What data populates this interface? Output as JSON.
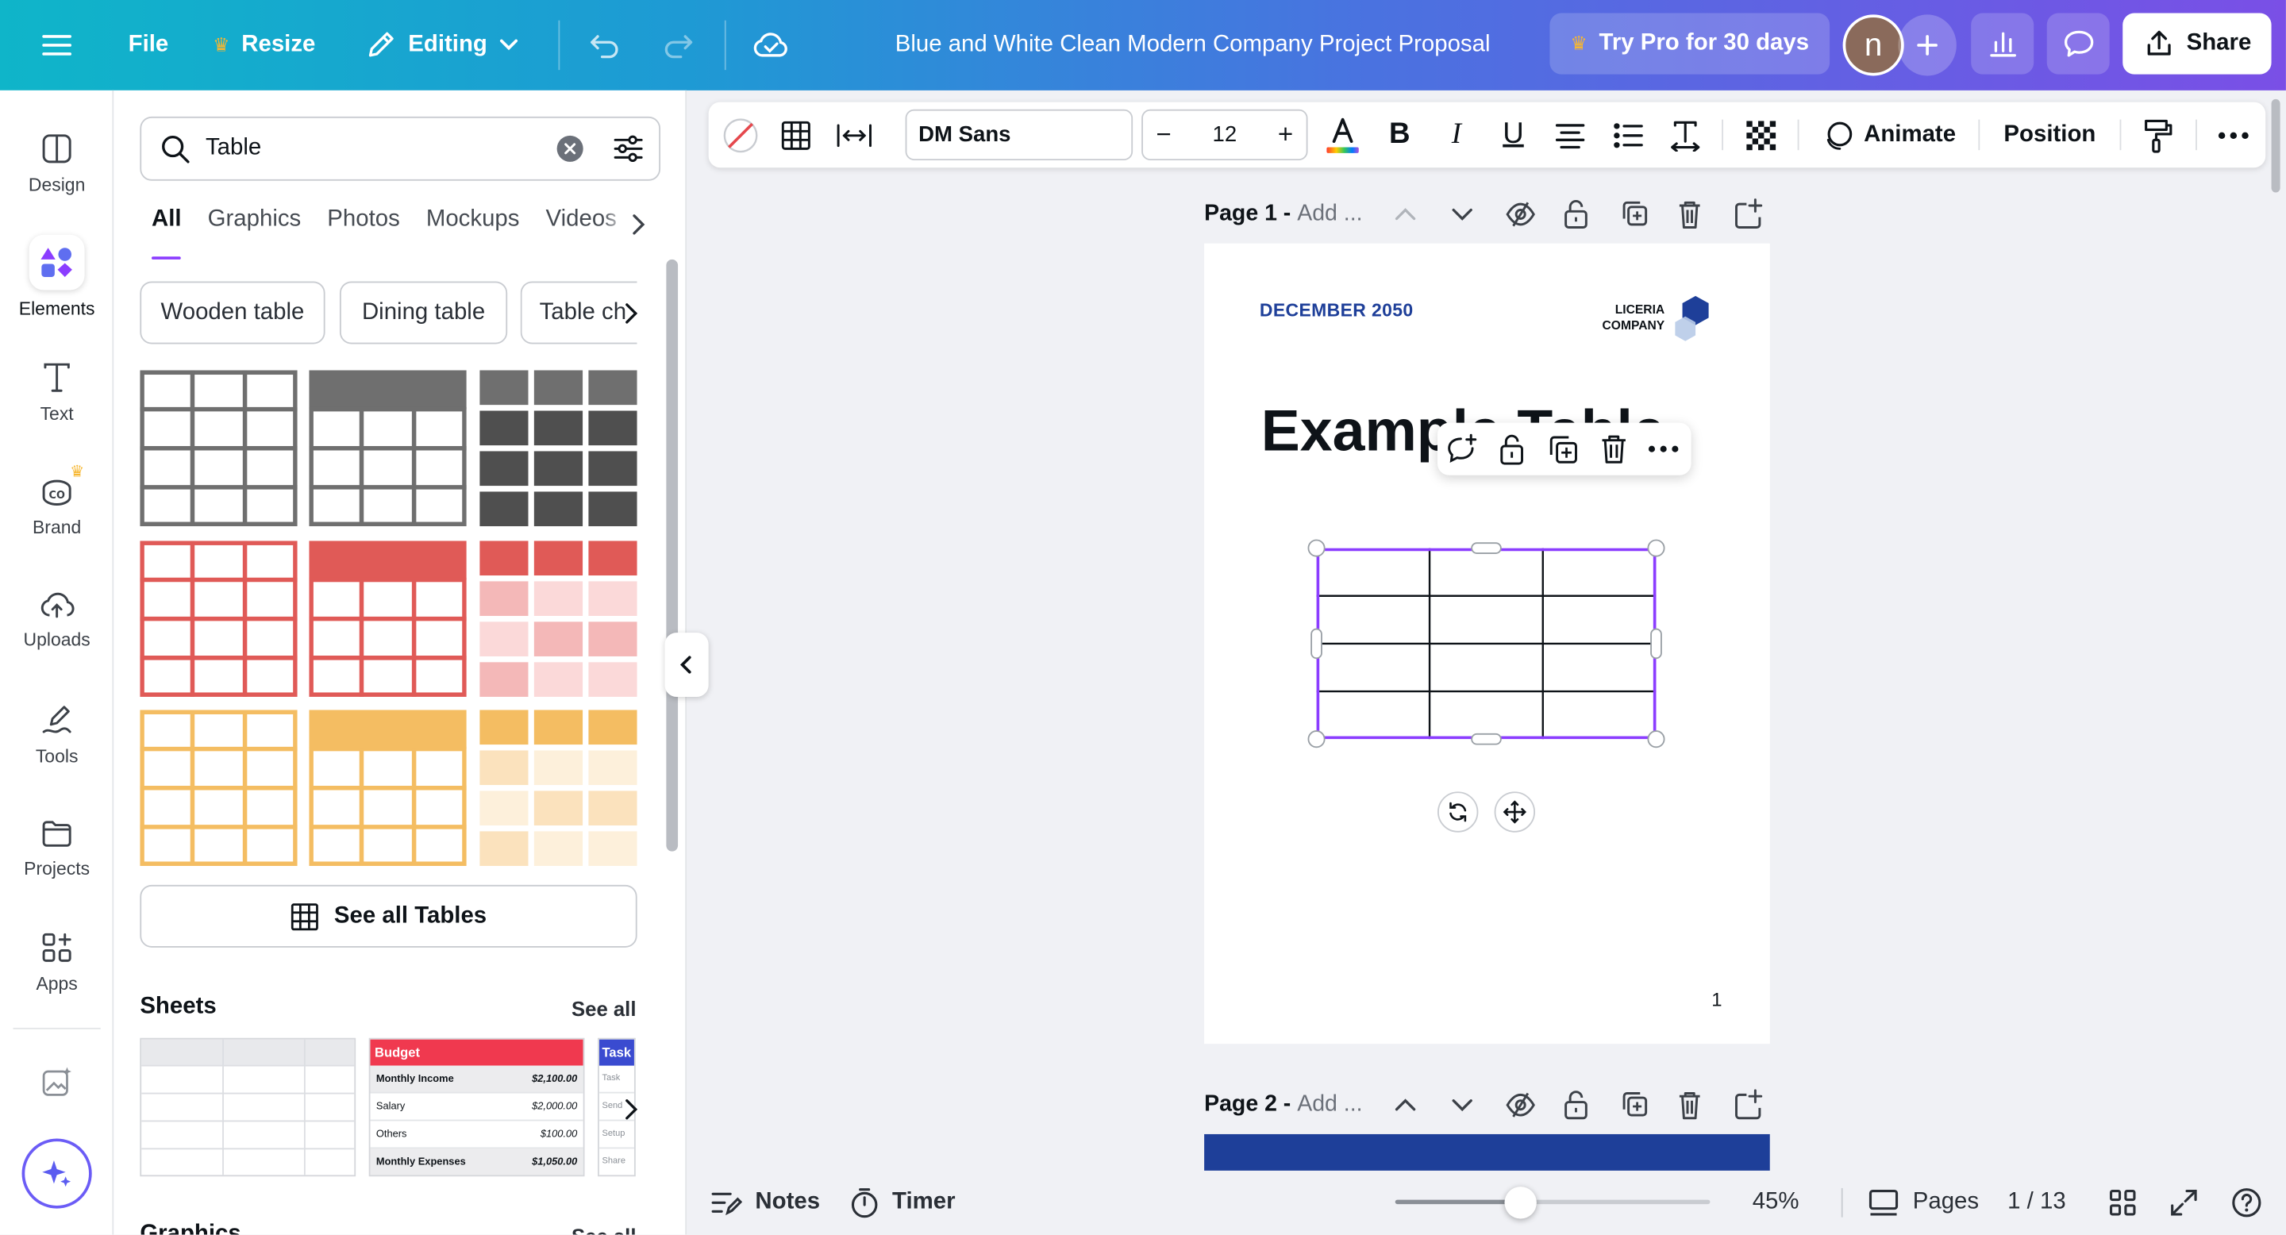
{
  "topbar": {
    "file": "File",
    "resize": "Resize",
    "editing": "Editing",
    "doc_title": "Blue and White Clean Modern Company Project Proposal",
    "try_pro": "Try Pro for 30 days",
    "avatar_letter": "n",
    "share": "Share",
    "crown_color": "#f7b731"
  },
  "rail": {
    "items": [
      {
        "label": "Design",
        "icon": "layout-icon"
      },
      {
        "label": "Elements",
        "icon": "shapes-icon"
      },
      {
        "label": "Text",
        "icon": "text-icon"
      },
      {
        "label": "Brand",
        "icon": "brand-icon"
      },
      {
        "label": "Uploads",
        "icon": "cloud-upload-icon"
      },
      {
        "label": "Tools",
        "icon": "pen-tool-icon"
      },
      {
        "label": "Projects",
        "icon": "folder-icon"
      },
      {
        "label": "Apps",
        "icon": "apps-grid-icon"
      }
    ]
  },
  "panel": {
    "search_value": "Table",
    "tabs": [
      "All",
      "Graphics",
      "Photos",
      "Mockups",
      "Videos"
    ],
    "chips": [
      "Wooden table",
      "Dining table",
      "Table ch"
    ],
    "see_all_tables": "See all Tables",
    "sheets_title": "Sheets",
    "see_all": "See all",
    "graphics_title": "Graphics",
    "sheet_budget": {
      "title": "Budget",
      "rows": [
        [
          "Monthly Income",
          "$2,100.00"
        ],
        [
          "Salary",
          "$2,000.00"
        ],
        [
          "Others",
          "$100.00"
        ],
        [
          "Monthly Expenses",
          "$1,050.00"
        ]
      ]
    },
    "sheet_tasks": {
      "title": "Task",
      "rows": [
        "Task",
        "Send",
        "Setup",
        "Share"
      ]
    },
    "table_colors": {
      "gray": "#6f6f6f",
      "gray_dark": "#4f4f4f",
      "red": "#e05a57",
      "red_light": "#f4b8b8",
      "red_lighter": "#fbd9d9",
      "yellow": "#f4bd62",
      "yellow_light": "#fbe2bd",
      "yellow_lighter": "#fdf0db"
    }
  },
  "toolbar": {
    "font": "DM Sans",
    "font_size": "12",
    "animate": "Animate",
    "position": "Position"
  },
  "canvas": {
    "page1_label": "Page 1 -",
    "page1_add": "Add ...",
    "page2_label": "Page 2 -",
    "page2_add": "Add ...",
    "date": "DECEMBER 2050",
    "company_line1": "LICERIA",
    "company_line2": "COMPANY",
    "heading": "Example Table",
    "page_number": "1",
    "brand_blue": "#1e3f99",
    "selection_color": "#8b3dff"
  },
  "bottom": {
    "notes": "Notes",
    "timer": "Timer",
    "zoom": "45%",
    "zoom_fraction": 0.4,
    "pages": "Pages",
    "page_count": "1 / 13"
  }
}
